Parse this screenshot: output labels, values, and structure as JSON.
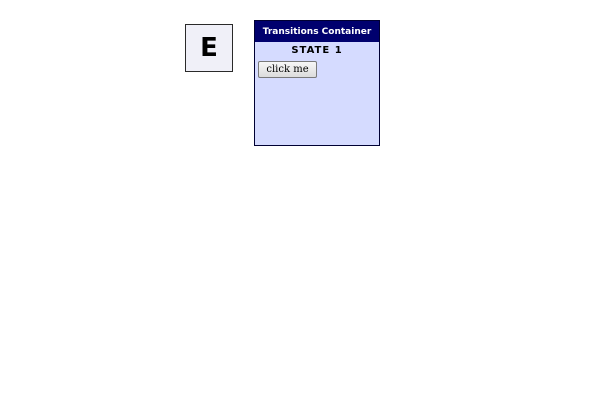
{
  "letter_box": {
    "letter": "E"
  },
  "transitions_container": {
    "title": "Transitions Container",
    "state_label": "STATE 1",
    "button_label": "click me"
  },
  "colors": {
    "header_bg": "#00006e",
    "container_bg": "#d5dbff",
    "letter_box_bg": "#f0f0f8"
  }
}
